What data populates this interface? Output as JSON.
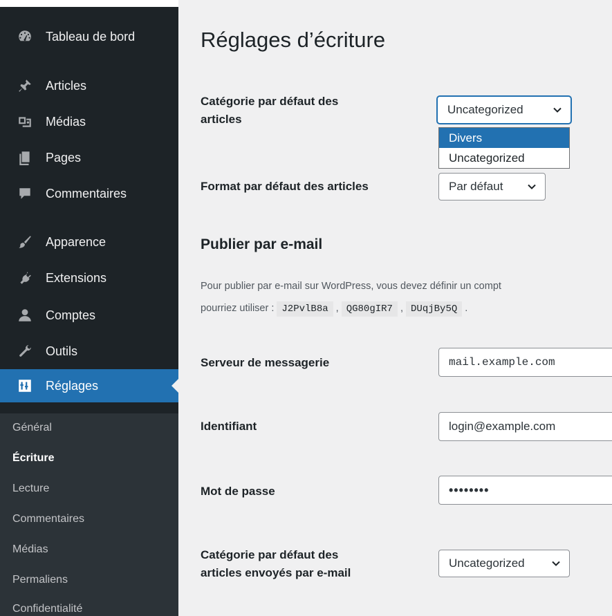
{
  "sidebar": {
    "items": [
      {
        "label": "Tableau de bord",
        "icon": "dashboard-icon"
      },
      {
        "label": "Articles",
        "icon": "pin-icon"
      },
      {
        "label": "Médias",
        "icon": "media-icon"
      },
      {
        "label": "Pages",
        "icon": "pages-icon"
      },
      {
        "label": "Commentaires",
        "icon": "comment-icon"
      },
      {
        "label": "Apparence",
        "icon": "brush-icon"
      },
      {
        "label": "Extensions",
        "icon": "plugin-icon"
      },
      {
        "label": "Comptes",
        "icon": "users-icon"
      },
      {
        "label": "Outils",
        "icon": "wrench-icon"
      },
      {
        "label": "Réglages",
        "icon": "settings-icon"
      }
    ],
    "submenu": [
      "Général",
      "Écriture",
      "Lecture",
      "Commentaires",
      "Médias",
      "Permaliens",
      "Confidentialité"
    ]
  },
  "page": {
    "title": "Réglages d’écriture",
    "default_category_label_line1": "Catégorie par défaut des",
    "default_category_label_line2": "articles",
    "default_category_value": "Uncategorized",
    "dropdown_options": [
      "Divers",
      "Uncategorized"
    ],
    "default_format_label": "Format par défaut des articles",
    "default_format_value": "Par défaut",
    "email_heading": "Publier par e-mail",
    "email_desc_line1": "Pour publier par e-mail sur WordPress, vous devez définir un compt",
    "email_desc_line2_prefix": "pourriez utiliser :",
    "codes": [
      "J2PvlB8a",
      "QG80gIR7",
      "DUqjBy5Q"
    ],
    "mail_server_label": "Serveur de messagerie",
    "mail_server_value": "mail.example.com",
    "login_label": "Identifiant",
    "login_value": "login@example.com",
    "password_label": "Mot de passe",
    "password_value": "••••••••",
    "email_category_label_line1": "Catégorie par défaut des",
    "email_category_label_line2": "articles envoyés par e-mail",
    "email_category_value": "Uncategorized"
  },
  "colors": {
    "sidebar_bg": "#1d2327",
    "active_bg": "#2271b1",
    "submenu_bg": "#2c3338",
    "page_bg": "#f0f0f1"
  }
}
